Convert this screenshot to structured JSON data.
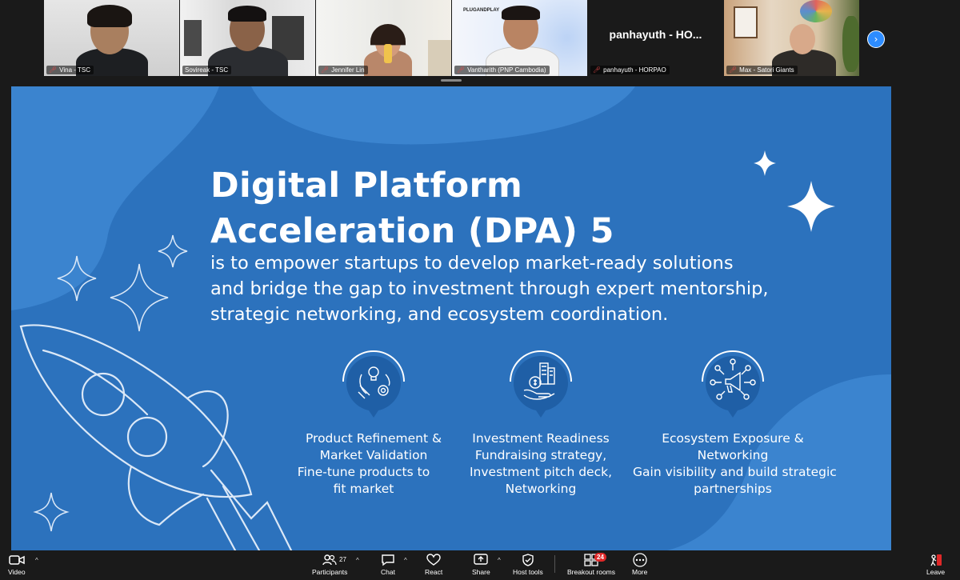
{
  "participants": [
    {
      "name": "Vina - TSC",
      "muted": true
    },
    {
      "name": "Sovireak - TSC",
      "muted": false,
      "active": true
    },
    {
      "name": "Jennifer Lin",
      "muted": true
    },
    {
      "name": "Vantharith (PNP Cambodia)",
      "muted": true,
      "poster": "PLUGANDPLAY"
    },
    {
      "name": "panhayuth - HORPAO",
      "muted": true,
      "display_name": "panhayuth  -  HO..."
    },
    {
      "name": "Max - Satori Giants",
      "muted": true
    }
  ],
  "slide": {
    "title_line1": "Digital Platform",
    "title_line2": "Acceleration (DPA) 5",
    "subtitle_lines": [
      "is to empower startups to develop market-ready solutions",
      "and bridge the gap to investment through expert mentorship,",
      "strategic networking, and ecosystem coordination."
    ],
    "features": [
      {
        "icon": "lightbulb-gear-icon",
        "lines": [
          "Product Refinement &",
          "Market Validation",
          "Fine-tune products to",
          "fit market"
        ]
      },
      {
        "icon": "hand-money-building-icon",
        "lines": [
          "Investment Readiness",
          "Fundraising strategy,",
          "Investment pitch deck,",
          "Networking"
        ]
      },
      {
        "icon": "megaphone-network-icon",
        "lines": [
          "Ecosystem Exposure &",
          "Networking",
          "Gain visibility and build strategic",
          "partnerships"
        ]
      }
    ]
  },
  "toolbar": {
    "video": "Video",
    "participants": "Participants",
    "participants_count": "27",
    "chat": "Chat",
    "react": "React",
    "share": "Share",
    "host_tools": "Host tools",
    "breakout_rooms": "Breakout rooms",
    "breakout_count": "24",
    "more": "More",
    "leave": "Leave"
  },
  "colors": {
    "slide_bg": "#2c72bd",
    "slide_bg_light": "#3b84cf",
    "accent_green": "#2fbf4a",
    "zoom_blue": "#2d8cff",
    "muted_red": "#e34a4a"
  }
}
